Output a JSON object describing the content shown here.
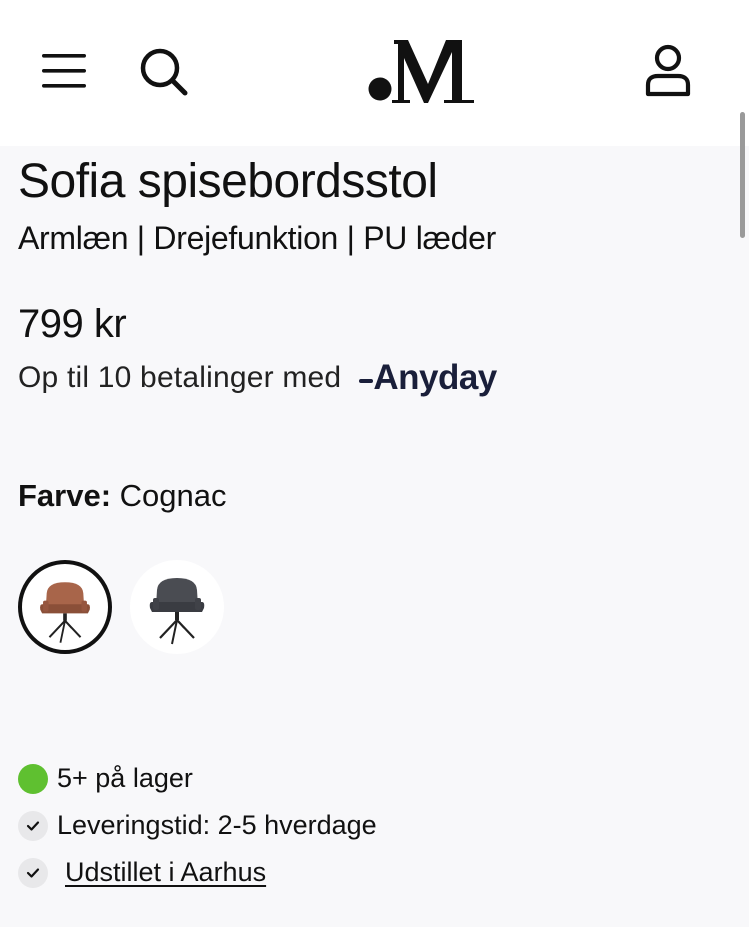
{
  "header": {
    "logo_text": ".M",
    "icons": [
      "menu-icon",
      "search-icon",
      "brand-logo",
      "user-icon"
    ]
  },
  "product": {
    "title": "Sofia spisebordsstol",
    "subtitle": "Armlæn | Drejefunktion | PU læder",
    "price": "799 kr",
    "installments_text": "Op til 10 betalinger med",
    "payment_provider": "Anyday",
    "color_label": "Farve:",
    "color_value": "Cognac",
    "swatches": [
      {
        "color": "Cognac",
        "hex": "#a8654a",
        "selected": true
      },
      {
        "color": "Grey",
        "hex": "#4a4c52",
        "selected": false
      }
    ]
  },
  "availability": {
    "stock": "5+ på lager",
    "delivery": "Leveringstid: 2-5 hverdage",
    "showroom": "Udstillet i Aarhus"
  },
  "colors": {
    "background": "#f8f8fa",
    "header": "#ffffff",
    "stock_green": "#5fc030",
    "anyday_navy": "#1a1f3a"
  }
}
